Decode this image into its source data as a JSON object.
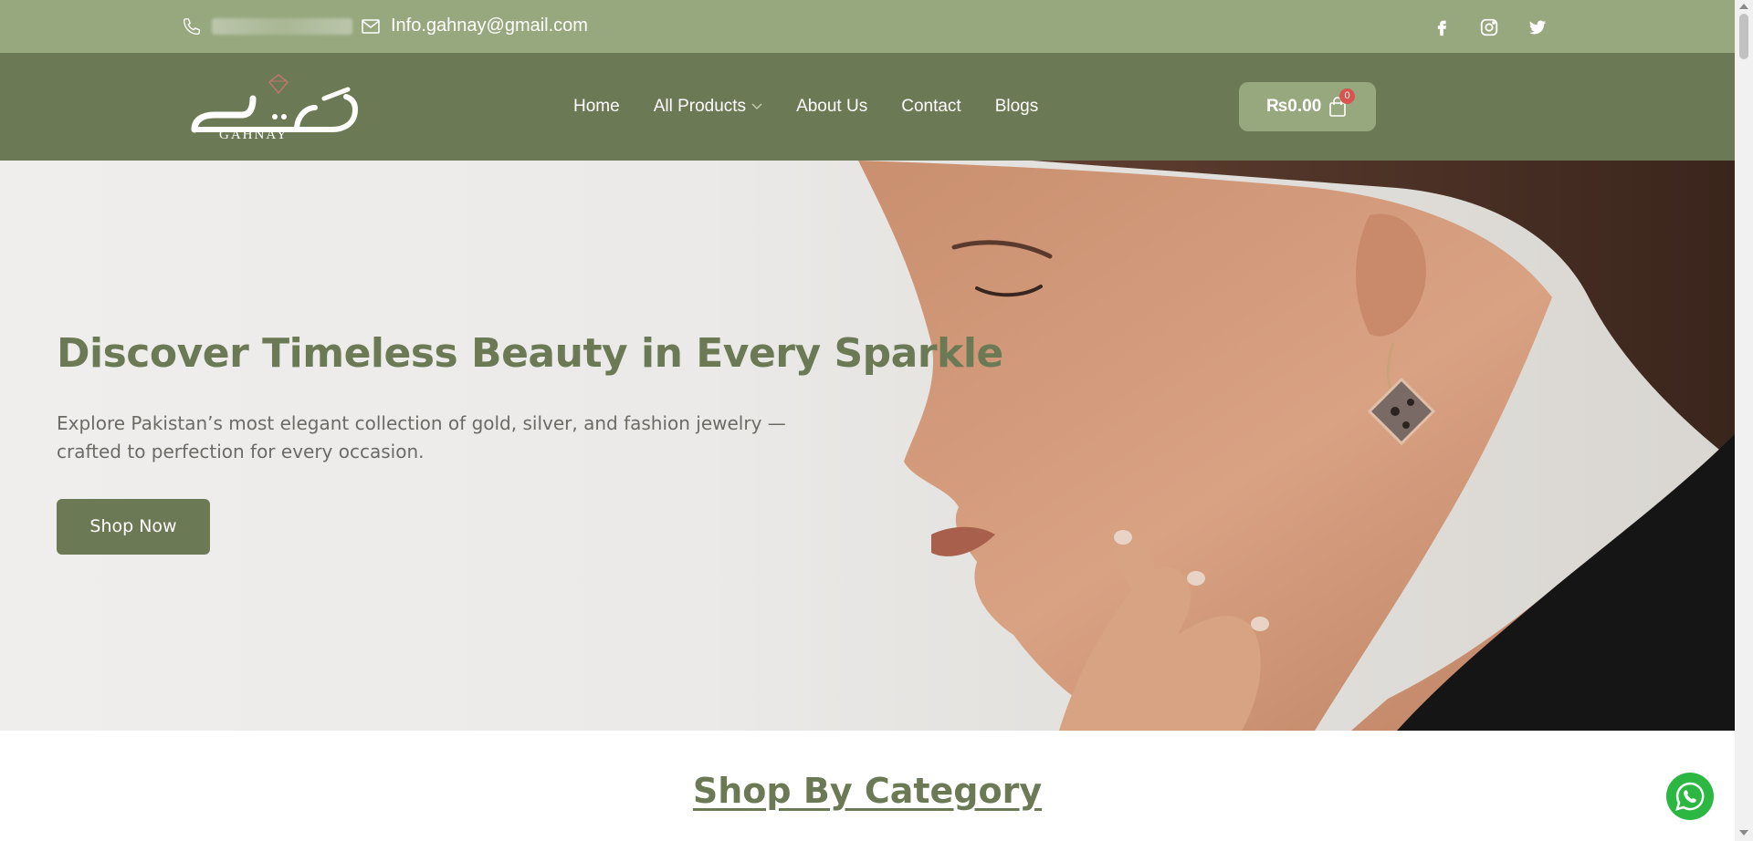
{
  "topbar": {
    "email": "Info.gahnay@gmail.com",
    "icons": [
      "phone-icon",
      "mail-icon",
      "facebook-icon",
      "instagram-icon",
      "twitter-icon"
    ]
  },
  "header": {
    "logo_text": "GAHNAY",
    "nav": [
      {
        "label": "Home"
      },
      {
        "label": "All Products"
      },
      {
        "label": "About Us"
      },
      {
        "label": "Contact"
      },
      {
        "label": "Blogs"
      }
    ],
    "cart_total": "₨0.00",
    "cart_count": "0"
  },
  "hero": {
    "title": "Discover Timeless Beauty in Every Sparkle",
    "subtitle": "Explore Pakistan’s most elegant collection of gold, silver, and fashion jewelry — crafted to perfection for every occasion.",
    "cta": "Shop Now"
  },
  "section": {
    "title": "Shop By Category"
  },
  "colors": {
    "topbar": "#97a87e",
    "header": "#6b7a55",
    "accent_text": "#6b7a55",
    "badge": "#d9534f",
    "whatsapp": "#2bb741"
  }
}
